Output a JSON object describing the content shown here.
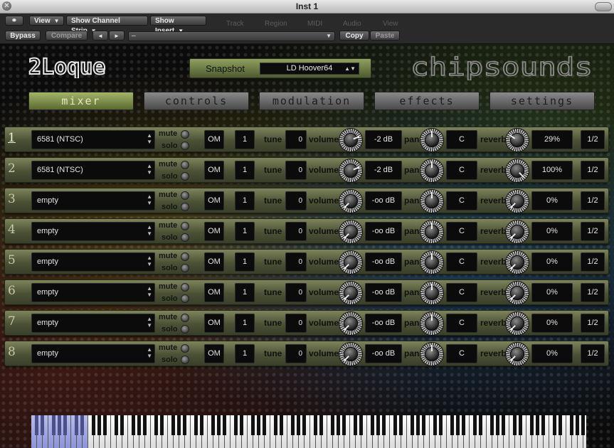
{
  "window": {
    "title": "Inst 1"
  },
  "host": {
    "view_label": "View",
    "channel_strip_label": "Show Channel Strip",
    "insert_label": "Show Insert",
    "ghost_menus": [
      "Track",
      "Region",
      "MIDI",
      "Audio",
      "View"
    ],
    "bypass_label": "Bypass",
    "compare_label": "Compare",
    "prev_label": "◄",
    "next_label": "►",
    "preset_value": "–",
    "copy_label": "Copy",
    "paste_label": "Paste"
  },
  "plugin": {
    "logo_text": "2Loque",
    "brand_text": "chipsounds",
    "snapshot_label": "Snapshot",
    "snapshot_value": "LD Hoover64",
    "tabs": [
      {
        "label": "mixer",
        "active": true
      },
      {
        "label": "controls",
        "active": false
      },
      {
        "label": "modulation",
        "active": false
      },
      {
        "label": "effects",
        "active": false
      },
      {
        "label": "settings",
        "active": false
      }
    ],
    "labels": {
      "mute": "mute",
      "solo": "solo",
      "tune": "tune",
      "volume": "volume",
      "pan": "pan",
      "reverb": "reverb"
    },
    "rows": [
      {
        "number": "1",
        "instrument": "6581 (NTSC)",
        "mode": "OM",
        "channel": "1",
        "tune": "0",
        "volume": "-2 dB",
        "volume_level": 0.75,
        "pan": "C",
        "reverb": "29%",
        "reverb_level": 0.29,
        "voices": "1/2",
        "selected": true
      },
      {
        "number": "2",
        "instrument": "6581 (NTSC)",
        "mode": "OM",
        "channel": "1",
        "tune": "0",
        "volume": "-2 dB",
        "volume_level": 0.75,
        "pan": "C",
        "reverb": "100%",
        "reverb_level": 1.0,
        "voices": "1/2",
        "selected": false
      },
      {
        "number": "3",
        "instrument": "empty",
        "mode": "OM",
        "channel": "1",
        "tune": "0",
        "volume": "-oo dB",
        "volume_level": 0.0,
        "pan": "C",
        "reverb": "0%",
        "reverb_level": 0.0,
        "voices": "1/2",
        "selected": false
      },
      {
        "number": "4",
        "instrument": "empty",
        "mode": "OM",
        "channel": "1",
        "tune": "0",
        "volume": "-oo dB",
        "volume_level": 0.0,
        "pan": "C",
        "reverb": "0%",
        "reverb_level": 0.0,
        "voices": "1/2",
        "selected": false
      },
      {
        "number": "5",
        "instrument": "empty",
        "mode": "OM",
        "channel": "1",
        "tune": "0",
        "volume": "-oo dB",
        "volume_level": 0.0,
        "pan": "C",
        "reverb": "0%",
        "reverb_level": 0.0,
        "voices": "1/2",
        "selected": false
      },
      {
        "number": "6",
        "instrument": "empty",
        "mode": "OM",
        "channel": "1",
        "tune": "0",
        "volume": "-oo dB",
        "volume_level": 0.0,
        "pan": "C",
        "reverb": "0%",
        "reverb_level": 0.0,
        "voices": "1/2",
        "selected": false
      },
      {
        "number": "7",
        "instrument": "empty",
        "mode": "OM",
        "channel": "1",
        "tune": "0",
        "volume": "-oo dB",
        "volume_level": 0.0,
        "pan": "C",
        "reverb": "0%",
        "reverb_level": 0.0,
        "voices": "1/2",
        "selected": false
      },
      {
        "number": "8",
        "instrument": "empty",
        "mode": "OM",
        "channel": "1",
        "tune": "0",
        "volume": "-oo dB",
        "volume_level": 0.0,
        "pan": "C",
        "reverb": "0%",
        "reverb_level": 0.0,
        "voices": "1/2",
        "selected": false
      }
    ]
  },
  "colors": {
    "active_tab": "#a2b46a",
    "row_panel": "#4b5135",
    "key_highlight": "#8c93d8"
  }
}
